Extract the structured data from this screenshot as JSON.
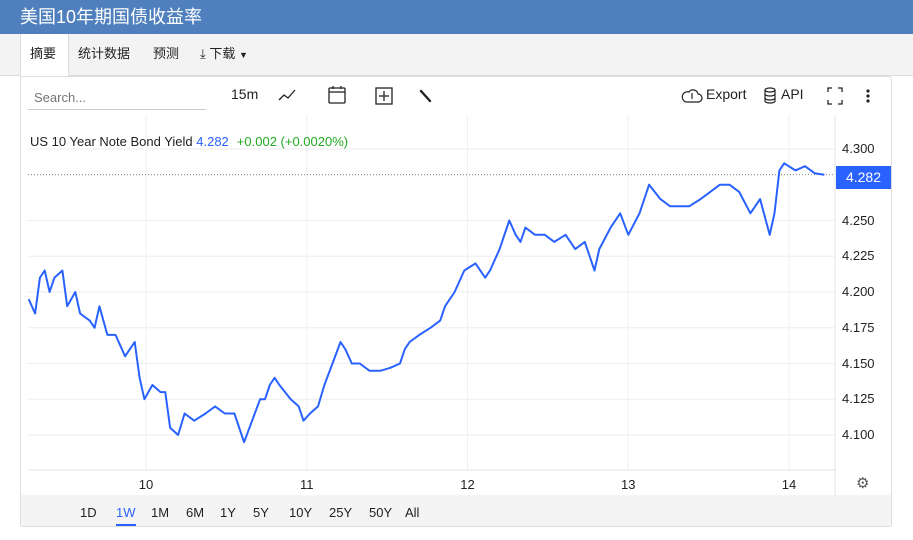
{
  "header": {
    "title": "美国10年期国债收益率"
  },
  "tabs": [
    {
      "label": "摘要"
    },
    {
      "label": "统计数据"
    },
    {
      "label": "预测"
    },
    {
      "label": "下载"
    }
  ],
  "toolbar": {
    "search_placeholder": "Search...",
    "interval": "15m",
    "export": "Export",
    "api": "API"
  },
  "legend": {
    "name": "US 10 Year Note Bond Yield",
    "value": "4.282",
    "change": "+0.002 (+0.0020%)"
  },
  "price_label": "4.282",
  "ranges": [
    "1D",
    "1W",
    "1M",
    "6M",
    "1Y",
    "5Y",
    "10Y",
    "25Y",
    "50Y",
    "All"
  ],
  "active_range": "1W",
  "colors": {
    "header": "#4f80bd",
    "line": "#2962ff",
    "up": "#22ab22"
  },
  "chart_data": {
    "type": "line",
    "title": "US 10 Year Note Bond Yield",
    "xlabel": "",
    "ylabel": "",
    "xlim": [
      9.266,
      14.3
    ],
    "ylim": [
      4.076,
      4.317
    ],
    "x_ticks": [
      10,
      11,
      12,
      13,
      14
    ],
    "x_tick_labels": [
      "10",
      "11",
      "12",
      "13",
      "14"
    ],
    "y_ticks": [
      4.1,
      4.125,
      4.15,
      4.175,
      4.2,
      4.225,
      4.25,
      4.3
    ],
    "y_tick_labels": [
      "4.100",
      "4.125",
      "4.150",
      "4.175",
      "4.200",
      "4.225",
      "4.250",
      "4.300"
    ],
    "last_value": 4.282,
    "series": [
      {
        "name": "US 10 Year Note Bond Yield",
        "x": [
          9.27,
          9.31,
          9.34,
          9.37,
          9.4,
          9.43,
          9.48,
          9.51,
          9.56,
          9.59,
          9.65,
          9.68,
          9.71,
          9.76,
          9.81,
          9.87,
          9.93,
          9.96,
          9.99,
          10.04,
          10.09,
          10.12,
          10.15,
          10.2,
          10.24,
          10.3,
          10.37,
          10.43,
          10.49,
          10.55,
          10.61,
          10.66,
          10.71,
          10.74,
          10.77,
          10.8,
          10.83,
          10.9,
          10.95,
          10.98,
          11.02,
          11.07,
          11.11,
          11.16,
          11.21,
          11.24,
          11.28,
          11.33,
          11.39,
          11.46,
          11.52,
          11.58,
          11.61,
          11.64,
          11.7,
          11.77,
          11.83,
          11.86,
          11.92,
          11.98,
          12.05,
          12.11,
          12.14,
          12.2,
          12.26,
          12.3,
          12.33,
          12.36,
          12.42,
          12.48,
          12.54,
          12.61,
          12.67,
          12.73,
          12.79,
          12.82,
          12.89,
          12.95,
          13.0,
          13.07,
          13.13,
          13.2,
          13.26,
          13.32,
          13.38,
          13.45,
          13.51,
          13.57,
          13.63,
          13.69,
          13.76,
          13.82,
          13.88,
          13.91,
          13.94,
          13.97,
          14.04,
          14.1,
          14.16,
          14.22
        ],
        "y": [
          4.195,
          4.185,
          4.21,
          4.215,
          4.2,
          4.21,
          4.215,
          4.19,
          4.2,
          4.185,
          4.18,
          4.175,
          4.19,
          4.17,
          4.17,
          4.155,
          4.165,
          4.14,
          4.125,
          4.135,
          4.13,
          4.13,
          4.105,
          4.1,
          4.115,
          4.11,
          4.115,
          4.12,
          4.115,
          4.115,
          4.095,
          4.11,
          4.125,
          4.125,
          4.135,
          4.14,
          4.135,
          4.125,
          4.12,
          4.11,
          4.115,
          4.12,
          4.135,
          4.15,
          4.165,
          4.16,
          4.15,
          4.15,
          4.145,
          4.145,
          4.147,
          4.15,
          4.16,
          4.165,
          4.17,
          4.175,
          4.18,
          4.19,
          4.2,
          4.215,
          4.22,
          4.21,
          4.215,
          4.23,
          4.25,
          4.24,
          4.235,
          4.245,
          4.24,
          4.24,
          4.235,
          4.24,
          4.23,
          4.235,
          4.215,
          4.23,
          4.245,
          4.255,
          4.24,
          4.255,
          4.275,
          4.265,
          4.26,
          4.26,
          4.26,
          4.265,
          4.27,
          4.275,
          4.275,
          4.27,
          4.255,
          4.265,
          4.24,
          4.255,
          4.285,
          4.29,
          4.285,
          4.288,
          4.283,
          4.282
        ]
      }
    ]
  }
}
